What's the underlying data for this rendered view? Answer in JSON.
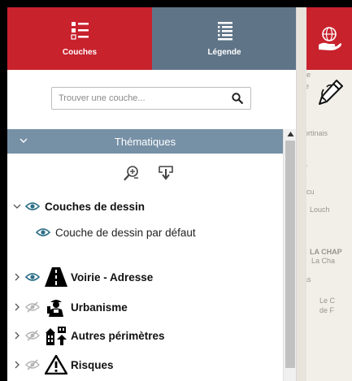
{
  "tabs": {
    "couches": {
      "label": "Couches",
      "icon": "layers-list-icon",
      "color": "#c8222d"
    },
    "legende": {
      "label": "Légende",
      "icon": "legend-list-icon",
      "color": "#5f7487"
    }
  },
  "search": {
    "placeholder": "Trouver une couche...",
    "value": "",
    "icon": "search-icon"
  },
  "section": {
    "title": "Thématiques",
    "color": "#7690a6",
    "expanded": true
  },
  "tools": [
    {
      "name": "zoom-add-icon"
    },
    {
      "name": "download-icon"
    }
  ],
  "layers": {
    "dessin": {
      "label": "Couches de dessin",
      "expanded": true,
      "visible": true,
      "children": [
        {
          "label": "Couche de dessin par défaut",
          "visible": true
        }
      ]
    },
    "voirie": {
      "label": "Voirie - Adresse",
      "visible": true,
      "icon": "road-icon"
    },
    "urbanisme": {
      "label": "Urbanisme",
      "visible": false,
      "icon": "worker-icon"
    },
    "perimetres": {
      "label": "Autres périmètres",
      "visible": false,
      "icon": "buildings-icon"
    },
    "risques": {
      "label": "Risques",
      "visible": false,
      "icon": "warning-icon"
    }
  },
  "map": {
    "labels": [
      "lle",
      "e",
      "rortinais",
      "e",
      "s",
      "cu",
      "Louch",
      "LA CHAP",
      "La Cha",
      "as",
      "Le C",
      "de F"
    ]
  }
}
